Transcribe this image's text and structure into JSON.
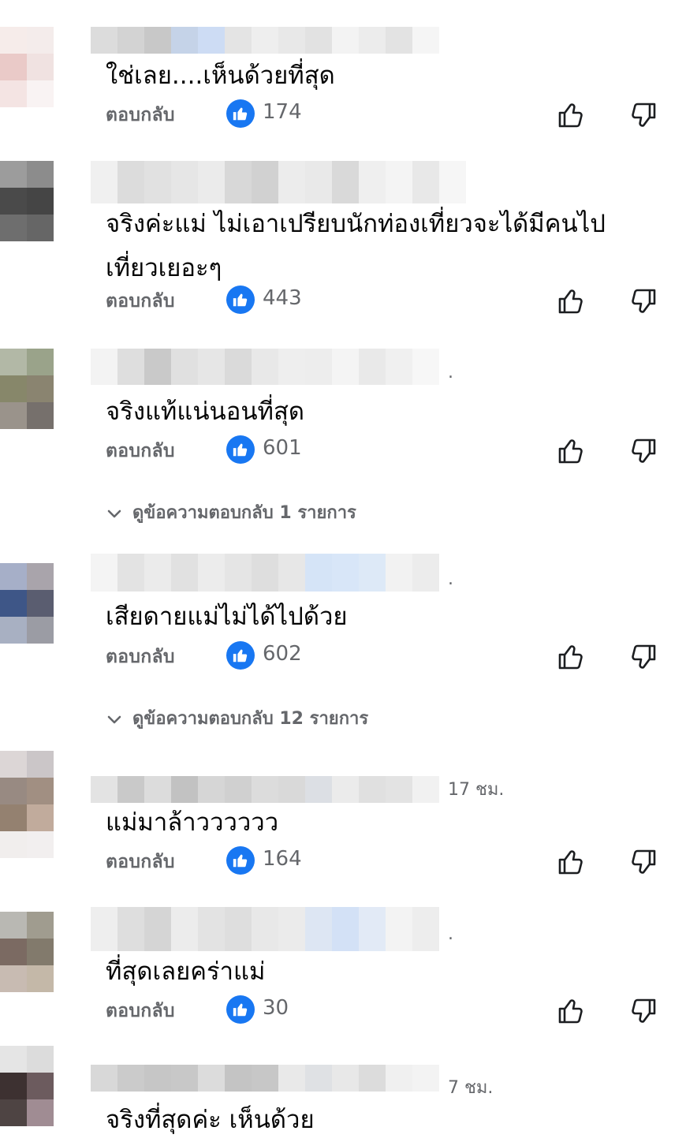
{
  "comments": [
    {
      "text": "ใช่เลย....เห็นด้วยที่สุด",
      "reply_label": "ตอบกลับ",
      "likes": "174",
      "meta": ""
    },
    {
      "text": "จริงค่ะแม่ ไม่เอาเปรียบนักท่องเที่ยวจะได้มีคนไปเที่ยวเยอะๆ",
      "reply_label": "ตอบกลับ",
      "likes": "443",
      "meta": ""
    },
    {
      "text": "จริงแท้แน่นอนที่สุด",
      "reply_label": "ตอบกลับ",
      "likes": "601",
      "meta": ".",
      "view_replies": "ดูข้อความตอบกลับ 1 รายการ"
    },
    {
      "text": "เสียดายแม่ไม่ได้ไปด้วย",
      "reply_label": "ตอบกลับ",
      "likes": "602",
      "meta": ".",
      "view_replies": "ดูข้อความตอบกลับ 12 รายการ"
    },
    {
      "text": "แม่มาล้าวววววว",
      "reply_label": "ตอบกลับ",
      "likes": "164",
      "meta": "17 ชม."
    },
    {
      "text": "ที่สุดเลยคร่าแม่",
      "reply_label": "ตอบกลับ",
      "likes": "30",
      "meta": "."
    },
    {
      "text": "จริงที่สุดค่ะ เห็นด้วย",
      "reply_label": "",
      "likes": "",
      "meta": "7 ชม."
    }
  ],
  "icons": {
    "like_badge": "like-thumb-icon",
    "thumb_up": "thumbs-up-icon",
    "thumb_down": "thumbs-down-icon",
    "chevron": "chevron-down-icon"
  },
  "colors": {
    "accent": "#1877f2",
    "secondary_text": "#65676b"
  }
}
